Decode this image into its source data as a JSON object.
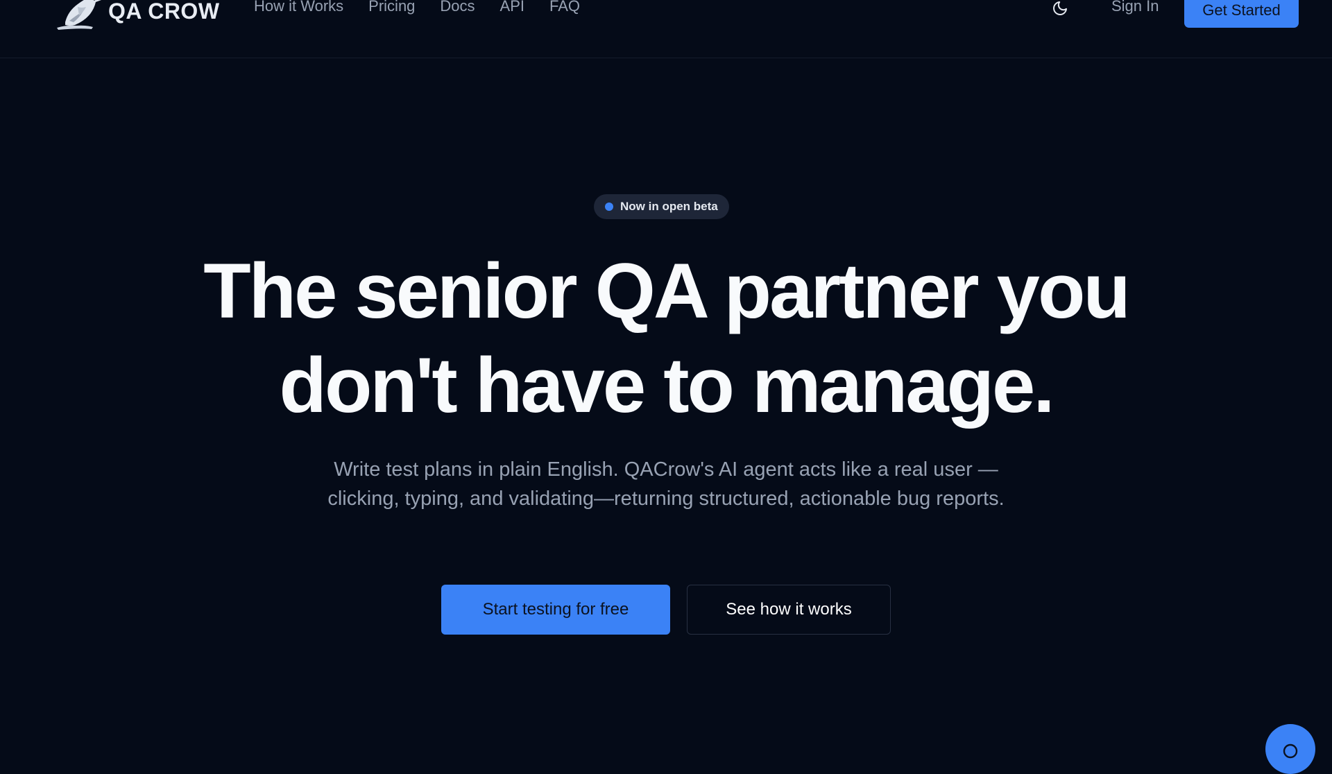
{
  "nav": {
    "logo_text": "QA CROW",
    "links": [
      "How it Works",
      "Pricing",
      "Docs",
      "API",
      "FAQ"
    ],
    "theme_icon": "moon-icon",
    "sign_in": "Sign In",
    "get_started": "Get Started"
  },
  "hero": {
    "badge": "Now in open beta",
    "headline_line1": "The senior QA partner you",
    "headline_line2": "don't have to manage.",
    "subhead": "Write test plans in plain English. QACrow's AI agent acts like a real user —clicking, typing, and validating—returning structured, actionable bug reports.",
    "cta_primary": "Start testing for free",
    "cta_secondary": "See how it works"
  },
  "chat_widget": {
    "icon": "chat-icon"
  },
  "colors": {
    "background": "#050b18",
    "accent": "#3b82f6",
    "muted_text": "#98a2b3",
    "headline": "#f8fafc"
  }
}
